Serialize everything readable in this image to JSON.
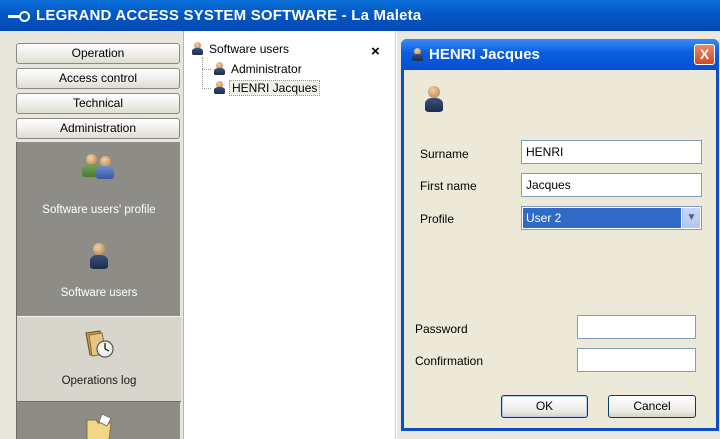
{
  "window": {
    "title": "LEGRAND ACCESS SYSTEM SOFTWARE - La Maleta"
  },
  "nav": {
    "buttons": [
      "Operation",
      "Access control",
      "Technical",
      "Administration"
    ],
    "tiles": [
      {
        "label": "Software users' profile",
        "icon": "users-group-icon"
      },
      {
        "label": "Software users",
        "icon": "user-icon"
      },
      {
        "label": "Operations log",
        "icon": "operations-log-icon",
        "selected": true
      },
      {
        "label": "",
        "icon": "folder-icon"
      }
    ]
  },
  "tree": {
    "root": "Software users",
    "close_label": "×",
    "items": [
      "Administrator",
      "HENRI Jacques"
    ],
    "selected": "HENRI Jacques"
  },
  "dialog": {
    "title": "HENRI Jacques",
    "close_label": "X",
    "fields": {
      "surname_label": "Surname",
      "surname_value": "HENRI",
      "firstname_label": "First name",
      "firstname_value": "Jacques",
      "profile_label": "Profile",
      "profile_value": "User 2",
      "password_label": "Password",
      "password_value": "",
      "confirmation_label": "Confirmation",
      "confirmation_value": ""
    },
    "ok_label": "OK",
    "cancel_label": "Cancel"
  },
  "colors": {
    "titlebar": "#0456c4",
    "dialog_border": "#0a4fc4",
    "nav_panel": "#8e8c86",
    "selection": "#316ac5"
  }
}
